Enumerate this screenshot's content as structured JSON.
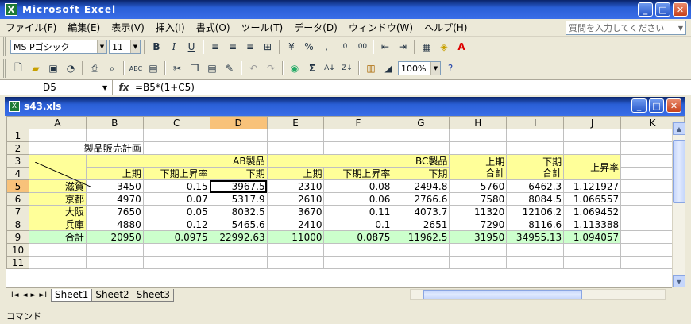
{
  "app": {
    "title": "Microsoft Excel",
    "icon_letter": "X"
  },
  "window_buttons": {
    "minimize": "_",
    "maximize": "□",
    "close": "✕"
  },
  "menu": [
    "ファイル(F)",
    "編集(E)",
    "表示(V)",
    "挿入(I)",
    "書式(O)",
    "ツール(T)",
    "データ(D)",
    "ウィンドウ(W)",
    "ヘルプ(H)"
  ],
  "help_box": {
    "placeholder": "質問を入力してください"
  },
  "toolbar": {
    "font_name": "MS Pゴシック",
    "font_size": "11",
    "zoom": "100%"
  },
  "formula_bar": {
    "cell_ref": "D5",
    "fx": "fx",
    "formula": "=B5*(1+C5)"
  },
  "workbook": {
    "title": "s43.xls"
  },
  "grid": {
    "columns": [
      "",
      "A",
      "B",
      "C",
      "D",
      "E",
      "F",
      "G",
      "H",
      "I",
      "J",
      "K"
    ],
    "rows": [
      "1",
      "2",
      "3",
      "4",
      "5",
      "6",
      "7",
      "8",
      "9",
      "10",
      "11"
    ],
    "title": "製品販売計画",
    "hdr_ab": "AB製品",
    "hdr_bc": "BC製品",
    "hdr_first": "上期",
    "hdr_rate": "下期上昇率",
    "hdr_second": "下期",
    "hdr_total_first": "上期\n合計",
    "hdr_total_first_1": "上期",
    "hdr_total_first_2": "合計",
    "hdr_total_second_1": "下期",
    "hdr_total_second_2": "合計",
    "hdr_rise": "上昇率",
    "data": [
      [
        "滋賀",
        "3450",
        "0.15",
        "3967.5",
        "2310",
        "0.08",
        "2494.8",
        "5760",
        "6462.3",
        "1.121927"
      ],
      [
        "京都",
        "4970",
        "0.07",
        "5317.9",
        "2610",
        "0.06",
        "2766.6",
        "7580",
        "8084.5",
        "1.066557"
      ],
      [
        "大阪",
        "7650",
        "0.05",
        "8032.5",
        "3670",
        "0.11",
        "4073.7",
        "11320",
        "12106.2",
        "1.069452"
      ],
      [
        "兵庫",
        "4880",
        "0.12",
        "5465.6",
        "2410",
        "0.1",
        "2651",
        "7290",
        "8116.6",
        "1.113388"
      ],
      [
        "合計",
        "20950",
        "0.0975",
        "22992.63",
        "11000",
        "0.0875",
        "11962.5",
        "31950",
        "34955.13",
        "1.094057"
      ]
    ]
  },
  "sheets": [
    "Sheet1",
    "Sheet2",
    "Sheet3"
  ],
  "tab_nav": [
    "I◄",
    "◄",
    "►",
    "►I"
  ],
  "status": {
    "mode": "コマンド"
  }
}
